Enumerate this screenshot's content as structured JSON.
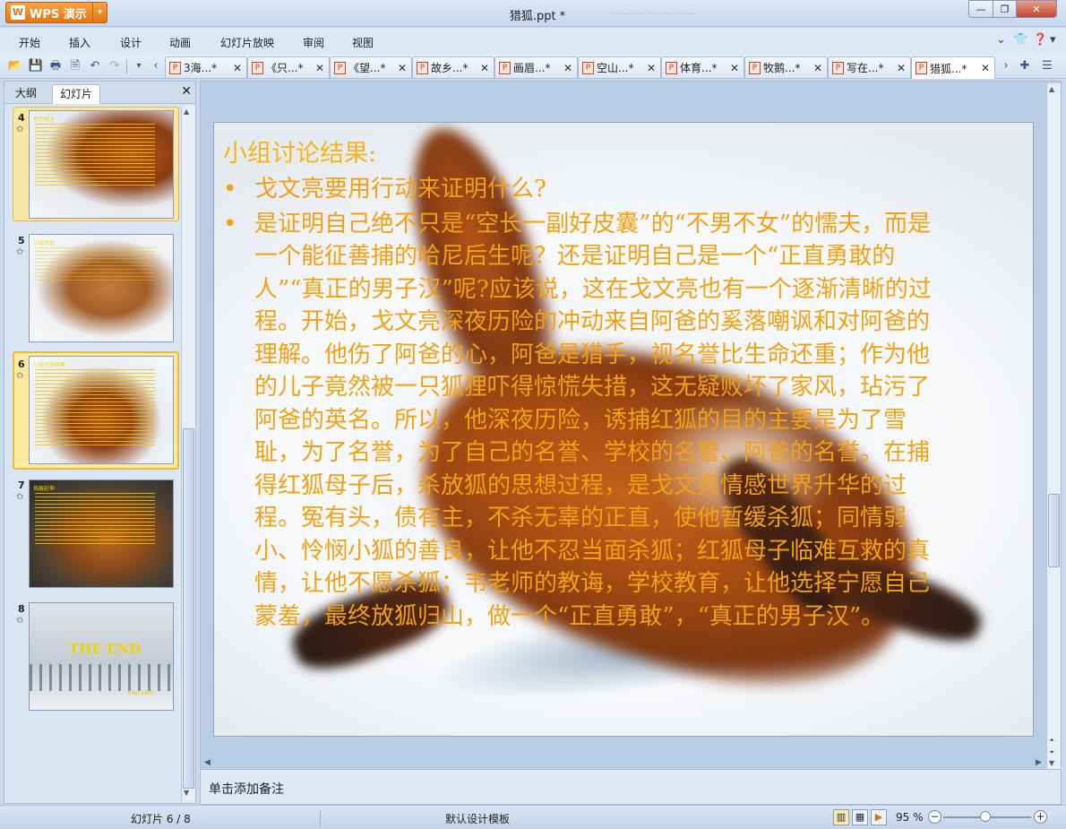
{
  "app": {
    "brand": "WPS 演示",
    "window_title": "猎狐.ppt *",
    "title_ghost": "— — — — — — —"
  },
  "menu": [
    "开始",
    "插入",
    "设计",
    "动画",
    "幻灯片放映",
    "审阅",
    "视图"
  ],
  "doc_tabs": [
    {
      "label": "3海...*"
    },
    {
      "label": "《只...*"
    },
    {
      "label": "《望...*"
    },
    {
      "label": "故乡...*"
    },
    {
      "label": "画眉...*"
    },
    {
      "label": "空山...*"
    },
    {
      "label": "体育...*"
    },
    {
      "label": "牧鹅...*"
    },
    {
      "label": "写在...*"
    },
    {
      "label": "猎狐...*"
    }
  ],
  "left_panel": {
    "tabs": [
      "大纲",
      "幻灯片"
    ],
    "thumbnails": [
      {
        "num": "4",
        "title": "写作特点"
      },
      {
        "num": "5",
        "title": "小组讨论"
      },
      {
        "num": "6",
        "title": "小组讨论结果"
      },
      {
        "num": "7",
        "title": "拓展延伸"
      },
      {
        "num": "8",
        "title": "THE END",
        "sub": "END  END"
      }
    ]
  },
  "slide": {
    "title": "小组讨论结果:",
    "bullets": [
      "戈文亮要用行动来证明什么?",
      "是证明自己绝不只是“空长一副好皮囊”的“不男不女”的懦夫，而是一个能征善捕的哈尼后生呢？还是证明自己是一个“正直勇敢的人”“真正的男子汉”呢?应该说，这在戈文亮也有一个逐渐清晰的过程。开始，戈文亮深夜历险的冲动来自阿爸的奚落嘲讽和对阿爸的理解。他伤了阿爸的心，阿爸是猎手，视名誉比生命还重；作为他的儿子竟然被一只狐狸吓得惊慌失措，这无疑败坏了家风，玷污了阿爸的英名。所以，他深夜历险，诱捕红狐的目的主要是为了雪耻，为了名誉，为了自己的名誉、学校的名誉、阿爸的名誉。在捕得红狐母子后，杀放狐的思想过程，是戈文亮情感世界升华的过程。冤有头，债有主，不杀无辜的正直，使他暂缓杀狐；同情弱小、怜悯小狐的善良，让他不忍当面杀狐；红狐母子临难互救的真情，让他不愿杀狐；韦老师的教诲，学校教育，让他选择宁愿自己蒙羞，最终放狐归山，做一个“正直勇敢”，“真正的男子汉”。"
    ]
  },
  "notes_placeholder": "单击添加备注",
  "status": {
    "slide_counter": "幻灯片 6 / 8",
    "template": "默认设计模板",
    "zoom": "95 %"
  },
  "colors": {
    "slide_text": "#f3a112",
    "brand_orange": "#e2760f"
  }
}
